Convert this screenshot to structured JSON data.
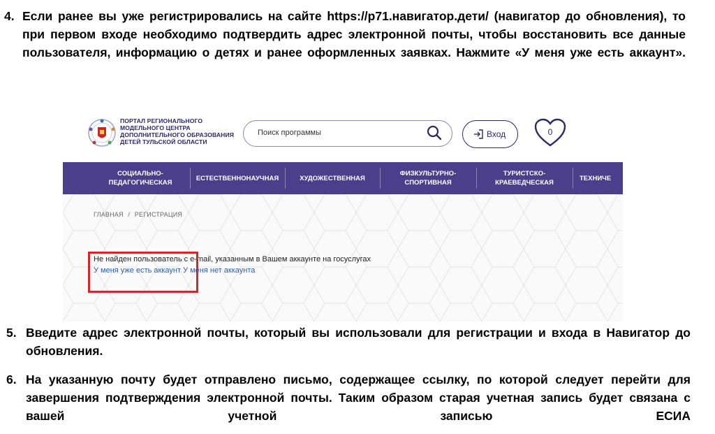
{
  "steps": [
    {
      "number": "4.",
      "text": "Если ранее вы уже регистрировались на сайте https://р71.навигатор.дети/ (навигатор до обновления), то при первом входе необходимо подтвердить адрес электронной почты, чтобы восстановить все данные пользователя, информацию о детях и ранее оформленных заявках. Нажмите «У меня уже есть аккаунт»."
    },
    {
      "number": "5.",
      "text": "Введите адрес электронной почты, который вы использовали для регистрации и входа в Навигатор до обновления."
    },
    {
      "number": "6.",
      "text": "На указанную почту будет отправлено письмо, содержащее ссылку, по которой следует перейти для завершения подтверждения электронной почты. Таким образом старая учетная запись будет связана с вашей учетной записью ЕСИА"
    }
  ],
  "site": {
    "logo_lines": [
      "ПОРТАЛ РЕГИОНАЛЬНОГО",
      "МОДЕЛЬНОГО ЦЕНТРА",
      "ДОПОЛНИТЕЛЬНОГО ОБРАЗОВАНИЯ",
      "ДЕТЕЙ ТУЛЬСКОЙ ОБЛАСТИ"
    ],
    "search_placeholder": "Поиск программы",
    "login_label": "Вход",
    "favorites_count": "0",
    "nav": [
      "СОЦИАЛЬНО-\nПЕДАГОГИЧЕСКАЯ",
      "ЕСТЕСТВЕННОНАУЧНАЯ",
      "ХУДОЖЕСТВЕННАЯ",
      "ФИЗКУЛЬТУРНО-\nСПОРТИВНАЯ",
      "ТУРИСТСКО-\nКРАЕВЕДЧЕСКАЯ",
      "ТЕХНИЧЕ"
    ],
    "breadcrumb": [
      "ГЛАВНАЯ",
      "/",
      "РЕГИСТРАЦИЯ"
    ],
    "message": "Не найден пользователь с e-mail, указанным в Вашем аккаунте на госуслугах",
    "link_have_account": "У меня уже есть аккаунт",
    "link_no_account": "У меня нет аккаунта"
  },
  "colors": {
    "nav_bg": "#4b3f8c",
    "brand_dark": "#2d2866",
    "link": "#2a5db0",
    "highlight": "#d8242a"
  }
}
